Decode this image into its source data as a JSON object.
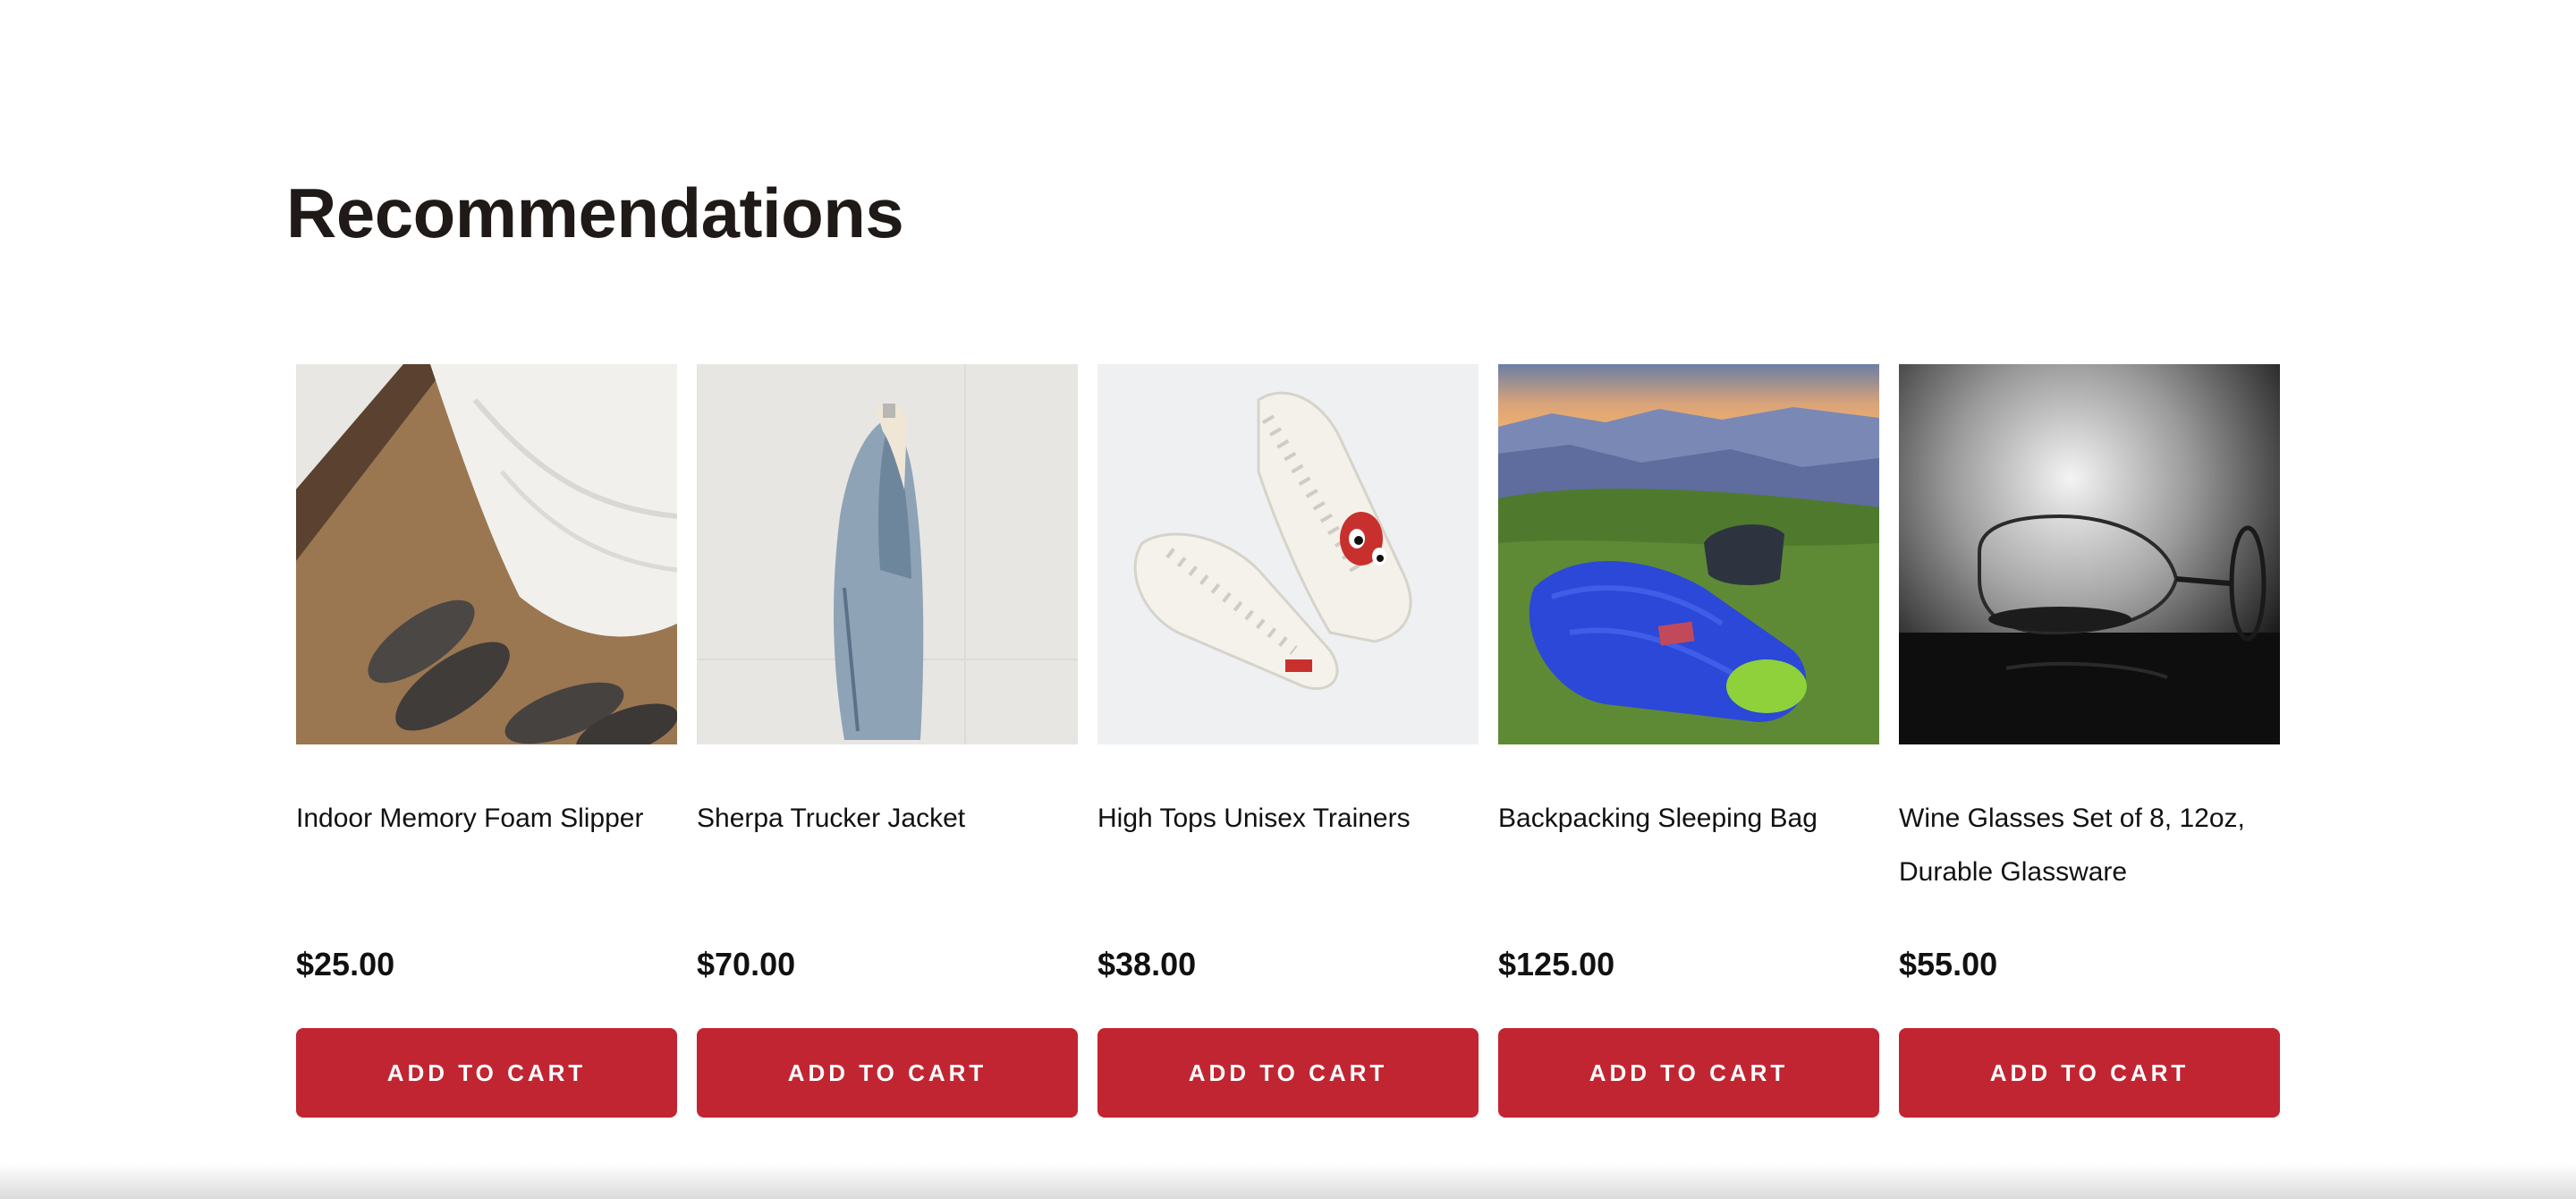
{
  "section": {
    "title": "Recommendations"
  },
  "products": [
    {
      "name": "Indoor Memory Foam Slipper",
      "price": "$25.00",
      "cta": "ADD TO CART",
      "image": "slippers-photo"
    },
    {
      "name": "Sherpa Trucker Jacket",
      "price": "$70.00",
      "cta": "ADD TO CART",
      "image": "denim-jacket-photo"
    },
    {
      "name": "High Tops Unisex Trainers",
      "price": "$38.00",
      "cta": "ADD TO CART",
      "image": "sneakers-photo"
    },
    {
      "name": "Backpacking Sleeping Bag",
      "price": "$125.00",
      "cta": "ADD TO CART",
      "image": "sleeping-bag-photo"
    },
    {
      "name": "Wine Glasses Set of 8, 12oz, Durable Glassware",
      "price": "$55.00",
      "cta": "ADD TO CART",
      "image": "wine-glass-photo"
    }
  ],
  "colors": {
    "accent": "#c22532",
    "title": "#1f1a17",
    "text": "#111111",
    "background": "#ffffff"
  }
}
